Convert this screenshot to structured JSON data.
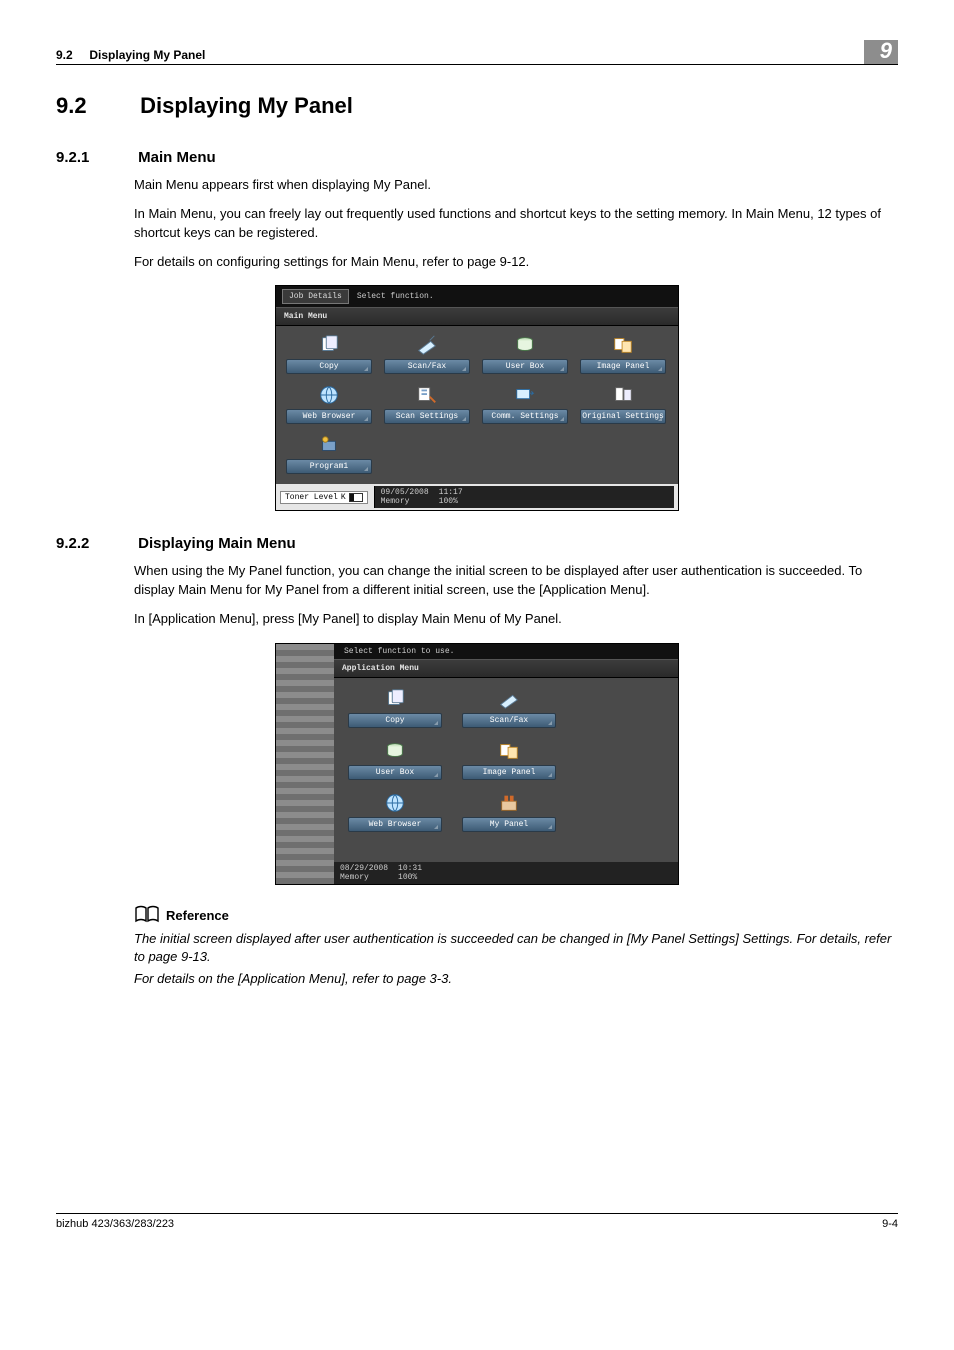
{
  "header": {
    "section_no": "9.2",
    "section_title": "Displaying My Panel",
    "chapter_tab": "9"
  },
  "h1": {
    "num": "9.2",
    "title": "Displaying My Panel"
  },
  "s1": {
    "num": "9.2.1",
    "title": "Main Menu",
    "p1": "Main Menu appears first when displaying My Panel.",
    "p2": "In Main Menu, you can freely lay out frequently used functions and shortcut keys to the setting memory. In Main Menu, 12 types of shortcut keys can be registered.",
    "p3": "For details on configuring settings for Main Menu, refer to page 9-12."
  },
  "panel1": {
    "job_btn": "Job Details",
    "top_msg": "Select function.",
    "menubar": "Main Menu",
    "items": [
      "Copy",
      "Scan/Fax",
      "User Box",
      "Image Panel",
      "Web Browser",
      "Scan Settings",
      "Comm. Settings",
      "Original Settings",
      "Program1"
    ],
    "toner_label": "Toner Level",
    "toner_k": "K",
    "date": "09/05/2008",
    "time": "11:17",
    "mem_label": "Memory",
    "mem_value": "100%"
  },
  "s2": {
    "num": "9.2.2",
    "title": "Displaying Main Menu",
    "p1": "When using the My Panel function, you can change the initial screen to be displayed after user authentication is succeeded. To display Main Menu for My Panel from a different initial screen, use the [Application Menu].",
    "p2": "In [Application Menu], press [My Panel] to display Main Menu of My Panel."
  },
  "panel2": {
    "top_msg": "Select function to use.",
    "menubar": "Application Menu",
    "items": [
      "Copy",
      "Scan/Fax",
      "User Box",
      "Image Panel",
      "Web Browser",
      "My Panel"
    ],
    "date": "08/29/2008",
    "time": "10:31",
    "mem_label": "Memory",
    "mem_value": "100%"
  },
  "reference": {
    "heading": "Reference",
    "p1": "The initial screen displayed after user authentication is succeeded can be changed in [My Panel Settings] Settings. For details, refer to page 9-13.",
    "p2": "For details on the [Application Menu], refer to page 3-3."
  },
  "footer": {
    "left": "bizhub 423/363/283/223",
    "right": "9-4"
  }
}
